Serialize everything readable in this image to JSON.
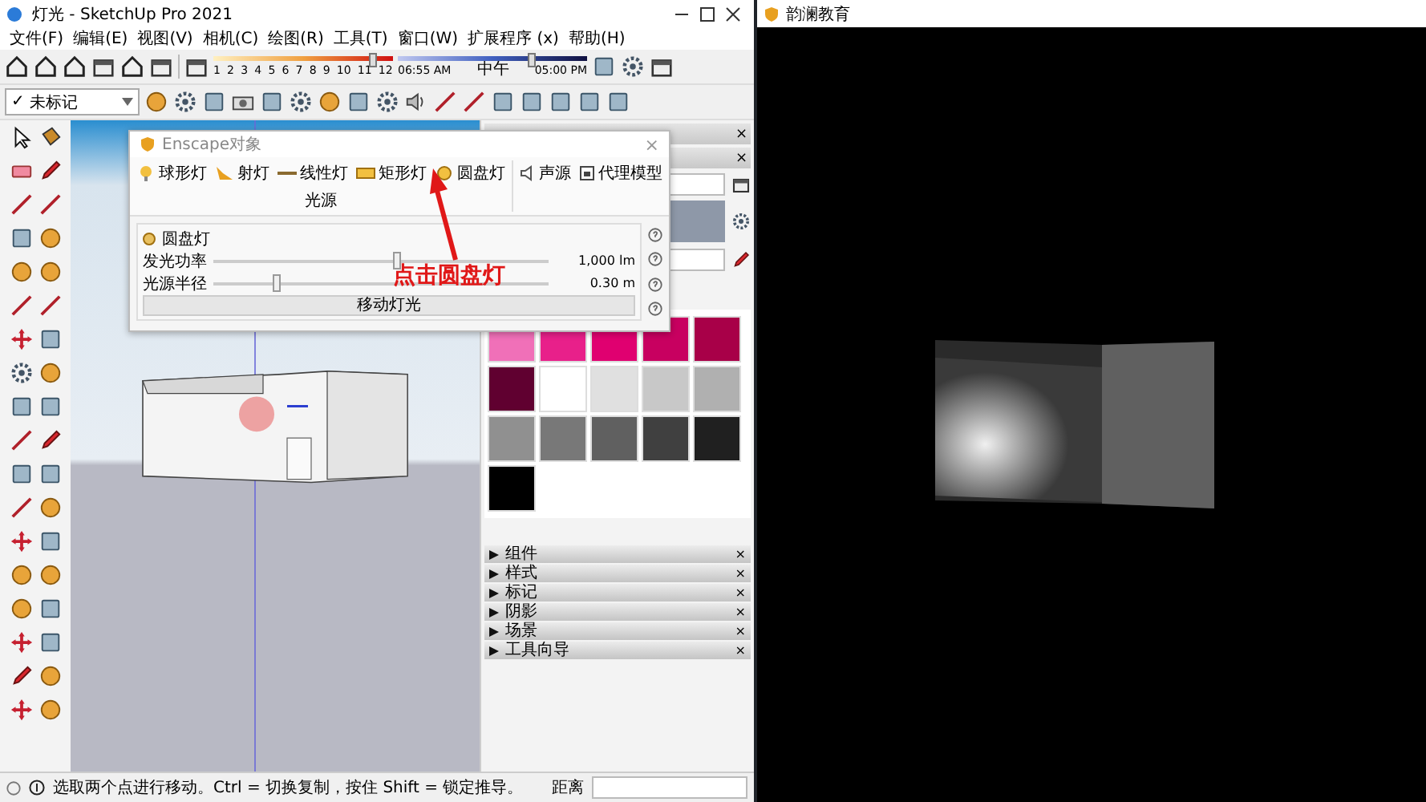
{
  "window": {
    "title": "灯光 - SketchUp Pro 2021"
  },
  "menu": [
    "文件(F)",
    "编辑(E)",
    "视图(V)",
    "相机(C)",
    "绘图(R)",
    "工具(T)",
    "窗口(W)",
    "扩展程序 (x)",
    "帮助(H)"
  ],
  "shadow_bar": {
    "months": [
      "1",
      "2",
      "3",
      "4",
      "5",
      "6",
      "7",
      "8",
      "9",
      "10",
      "11",
      "12"
    ],
    "month_slider": {
      "level": 0.88
    },
    "time_start": "06:55 AM",
    "time_mid": "中午",
    "time_end": "05:00 PM",
    "time_slider": {
      "level": 0.7
    }
  },
  "tag_dropdown": {
    "check": "✓",
    "value": "未标记"
  },
  "enscape_dialog": {
    "title": "Enscape对象",
    "close": "×",
    "light_types": [
      {
        "label": "球形灯",
        "kind": "bulb"
      },
      {
        "label": "射灯",
        "kind": "spot"
      },
      {
        "label": "线性灯",
        "kind": "line"
      },
      {
        "label": "矩形灯",
        "kind": "rect"
      },
      {
        "label": "圆盘灯",
        "kind": "disk"
      }
    ],
    "group_label": "光源",
    "extras": [
      {
        "label": "声源",
        "kind": "speaker"
      },
      {
        "label": "代理模型",
        "kind": "proxy"
      }
    ],
    "section_title": "圆盘灯",
    "sliders": [
      {
        "label": "发光功率",
        "level": 0.55,
        "reading": "1,000 lm"
      },
      {
        "label": "光源半径",
        "level": 0.19,
        "reading": "0.30 m"
      }
    ],
    "button": "移动灯光"
  },
  "annotation": "点击圆盘灯",
  "tray": {
    "panel_closes": [
      "×",
      "×"
    ],
    "swatches": [
      {
        "color": "#f070b8"
      },
      {
        "color": "#e8208a"
      },
      {
        "color": "#e00070"
      },
      {
        "color": "#c80060"
      },
      {
        "color": "#a80048"
      },
      {
        "color": "#600030"
      },
      {
        "color": "#ffffff"
      },
      {
        "color": "#e0e0e0"
      },
      {
        "color": "#c8c8c8"
      },
      {
        "color": "#b0b0b0"
      },
      {
        "color": "#909090"
      },
      {
        "color": "#787878"
      },
      {
        "color": "#606060"
      },
      {
        "color": "#404040"
      },
      {
        "color": "#202020"
      },
      {
        "color": "#000000"
      }
    ],
    "sections": [
      {
        "label": "组件",
        "close": "×"
      },
      {
        "label": "样式",
        "close": "×"
      },
      {
        "label": "标记",
        "close": "×"
      },
      {
        "label": "阴影",
        "close": "×"
      },
      {
        "label": "场景",
        "close": "×"
      },
      {
        "label": "工具向导",
        "close": "×"
      }
    ]
  },
  "status_bar": {
    "message": "选取两个点进行移动。Ctrl = 切换复制，按住 Shift = 锁定推导。",
    "distance_label": "距离"
  },
  "preview_window": {
    "title": "韵澜教育"
  }
}
